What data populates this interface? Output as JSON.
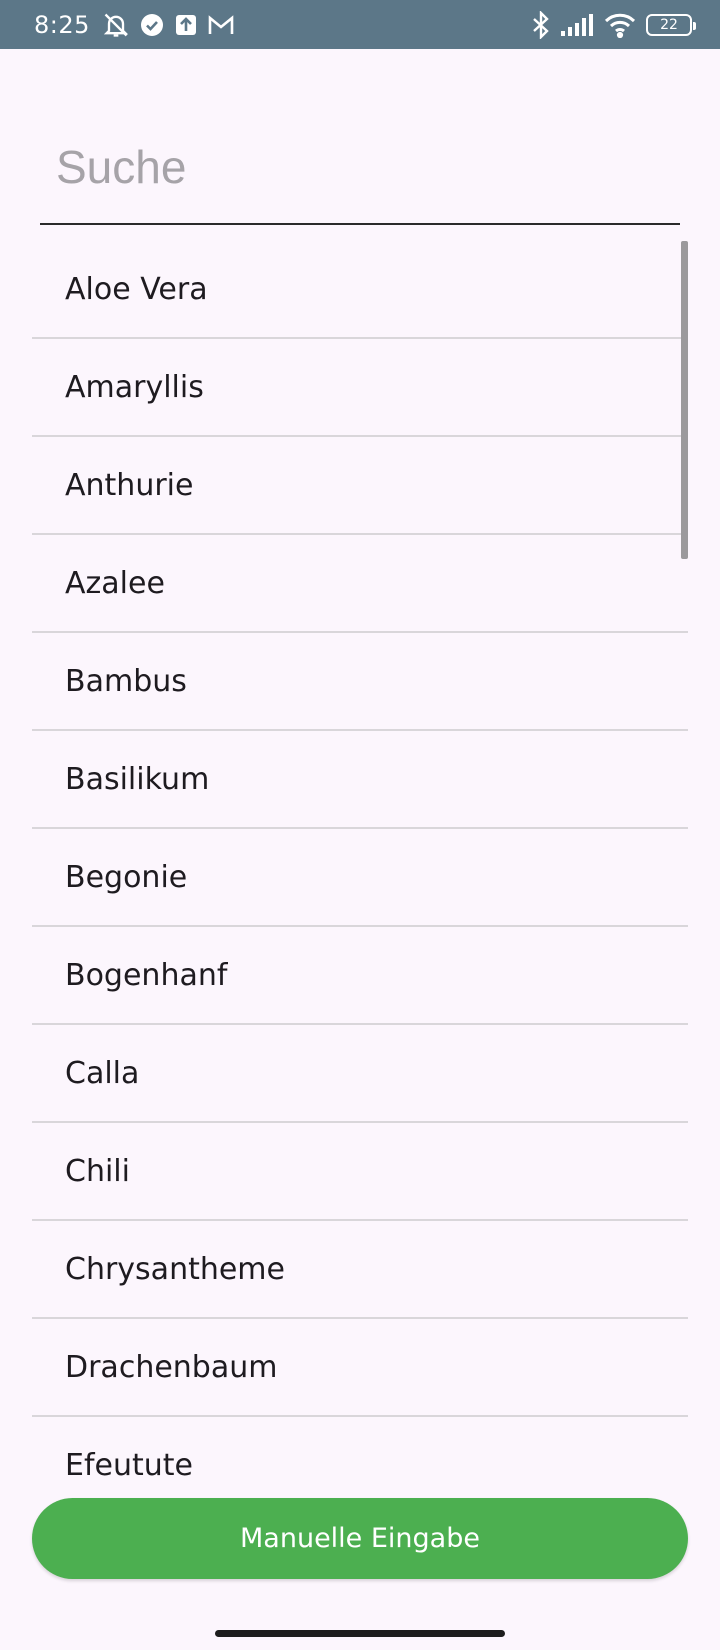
{
  "status_bar": {
    "time": "8:25",
    "battery": "22",
    "left_icons": [
      "muted-bell-icon",
      "check-circle-icon",
      "upload-icon",
      "gmail-icon"
    ],
    "right_icons": [
      "bluetooth-icon",
      "signal-icon",
      "wifi-icon",
      "battery-icon"
    ]
  },
  "search": {
    "placeholder": "Suche",
    "value": ""
  },
  "plants": [
    "Aloe Vera",
    "Amaryllis",
    "Anthurie",
    "Azalee",
    "Bambus",
    "Basilikum",
    "Begonie",
    "Bogenhanf",
    "Calla",
    "Chili",
    "Chrysantheme",
    "Drachenbaum",
    "Efeutute"
  ],
  "actions": {
    "manual_entry": "Manuelle Eingabe"
  },
  "colors": {
    "status_bar": "#5c7788",
    "background": "#fcf6fd",
    "accent": "#4caf50",
    "divider": "#d9d6da"
  }
}
